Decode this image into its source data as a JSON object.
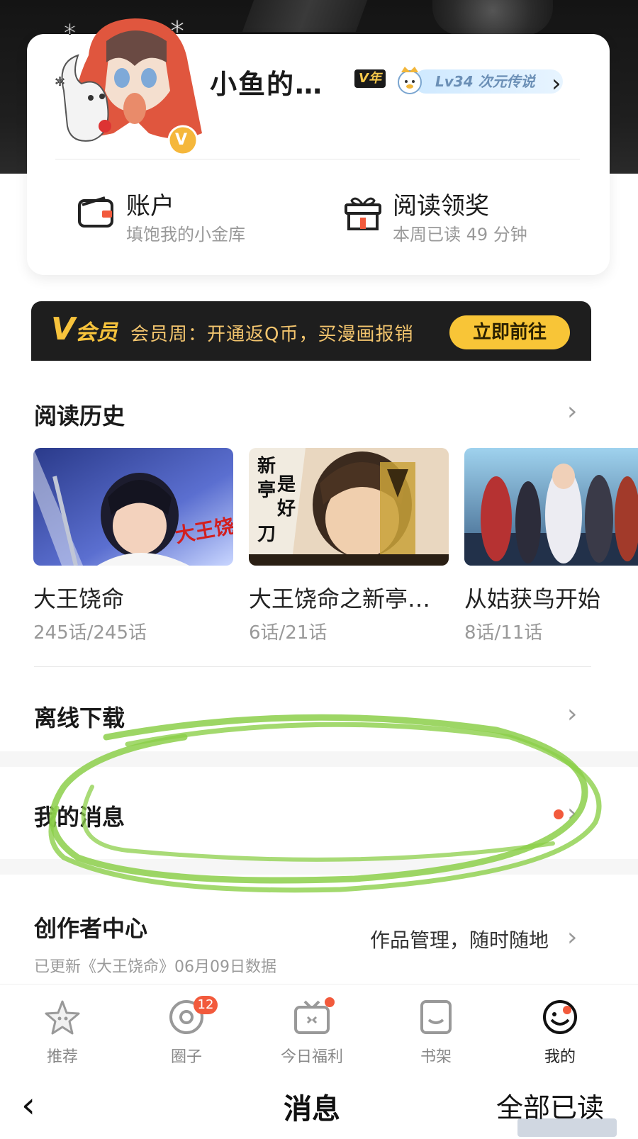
{
  "profile": {
    "username": "小鱼的…",
    "vip_year_badge": "V年",
    "level_text": "Lv34 次元传说",
    "avatar_badge": "V"
  },
  "stats": {
    "account": {
      "title": "账户",
      "sub": "填饱我的小金库"
    },
    "reading_reward": {
      "title": "阅读领奖",
      "sub": "本周已读 49 分钟"
    }
  },
  "vip_banner": {
    "logo": "V",
    "logo_suffix": "会员",
    "text": "会员周：开通返Q币，买漫画报销",
    "button": "立即前往"
  },
  "history": {
    "title": "阅读历史",
    "items": [
      {
        "name": "大王饶命",
        "progress": "245话/245话"
      },
      {
        "name": "大王饶命之新亭…",
        "progress": "6话/21话"
      },
      {
        "name": "从姑获鸟开始",
        "progress": "8话/11话"
      }
    ],
    "thumb_art": [
      "大王饶命",
      "新亭是好刀"
    ]
  },
  "menu": {
    "offline": "离线下载",
    "messages": "我的消息",
    "creator": {
      "title": "创作者中心",
      "sub": "已更新《大王饶命》06月09日数据",
      "right": "作品管理，随时随地"
    }
  },
  "tabs": [
    {
      "label": "推荐",
      "icon": "star-icon"
    },
    {
      "label": "圈子",
      "icon": "circle-icon",
      "badge": "12"
    },
    {
      "label": "今日福利",
      "icon": "tv-icon"
    },
    {
      "label": "书架",
      "icon": "bookshelf-icon"
    },
    {
      "label": "我的",
      "icon": "me-icon"
    }
  ],
  "bottom_bar": {
    "title": "消息",
    "right": "全部已读"
  },
  "colors": {
    "accent_yellow": "#f8c537",
    "dot_red": "#f25a3c",
    "annotation_green": "#8ccf4a"
  }
}
